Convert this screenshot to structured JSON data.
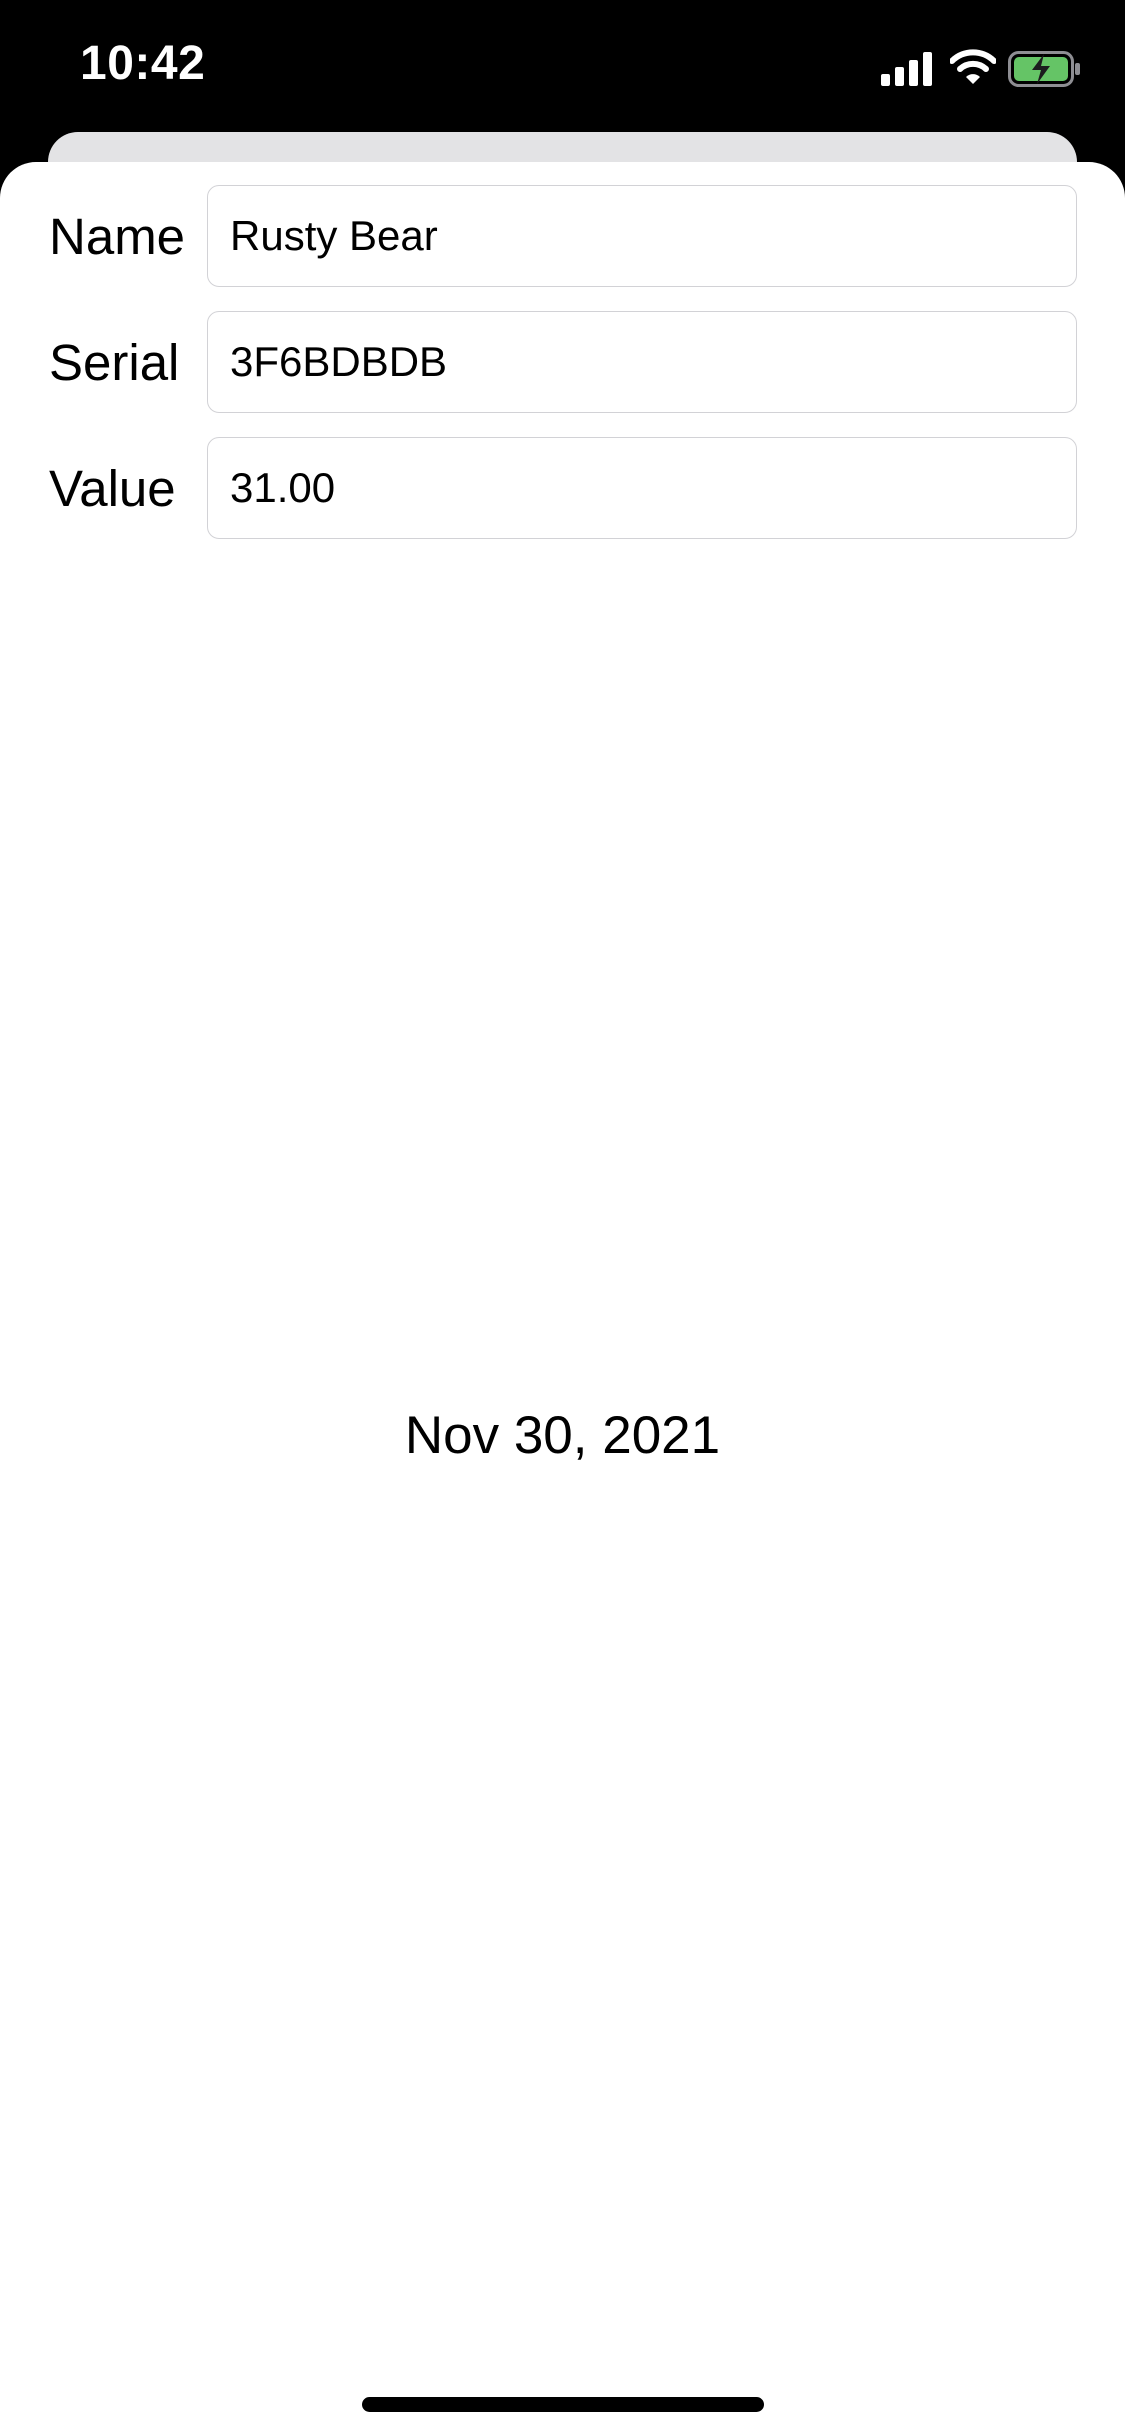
{
  "status_bar": {
    "time": "10:42",
    "icons": [
      "signal-icon",
      "wifi-icon",
      "battery-charging-icon"
    ],
    "battery_color": "#65c466"
  },
  "form": {
    "name": {
      "label": "Name",
      "value": "Rusty Bear"
    },
    "serial": {
      "label": "Serial",
      "value": "3F6BDBDB"
    },
    "value": {
      "label": "Value",
      "value": "31.00"
    }
  },
  "date_created": "Nov 30, 2021"
}
